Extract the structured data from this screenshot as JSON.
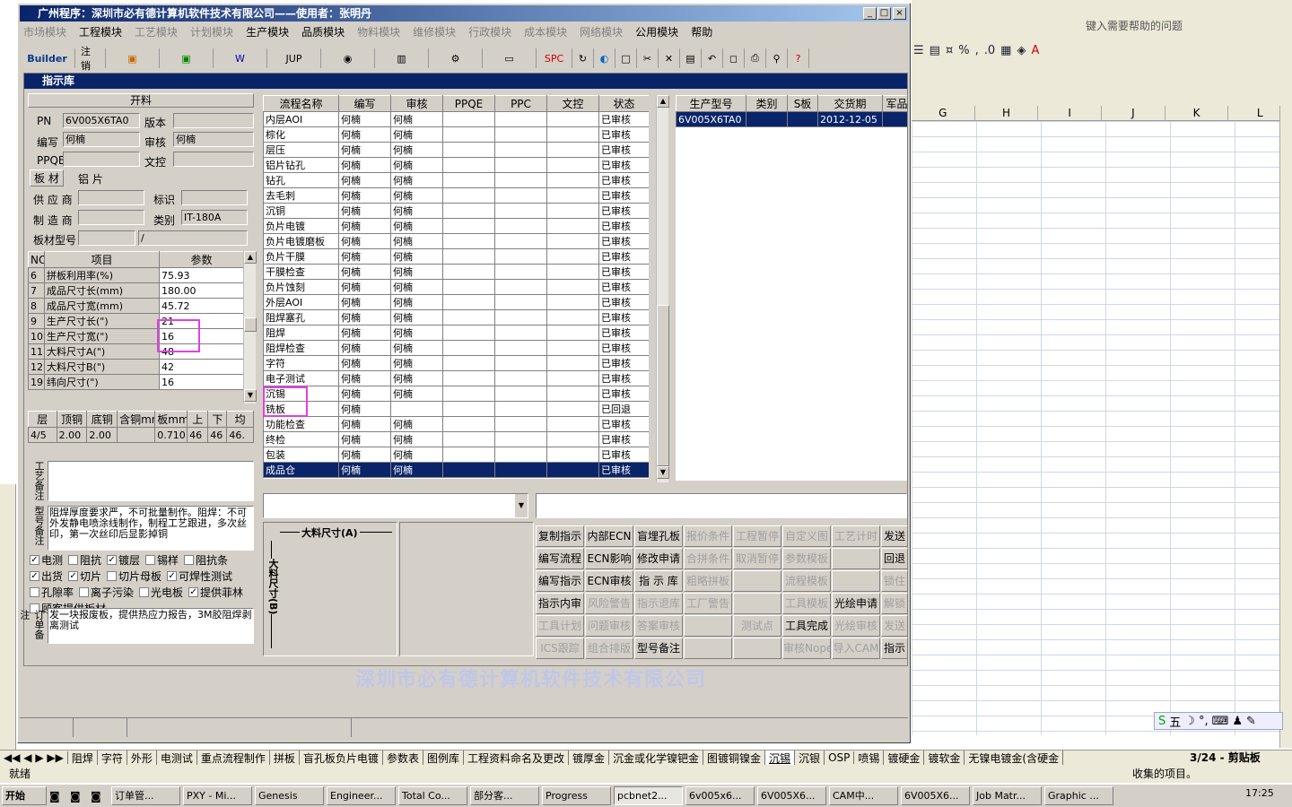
{
  "window": {
    "title": "广州程序：深圳市必有德计算机软件技术有限公司——使用者：张明丹"
  },
  "menu": [
    {
      "label": "市场模块",
      "enabled": false
    },
    {
      "label": "工程模块",
      "enabled": true
    },
    {
      "label": "工艺模块",
      "enabled": false
    },
    {
      "label": "计划模块",
      "enabled": false
    },
    {
      "label": "生产模块",
      "enabled": true
    },
    {
      "label": "品质模块",
      "enabled": true
    },
    {
      "label": "物料模块",
      "enabled": false
    },
    {
      "label": "维修模块",
      "enabled": false
    },
    {
      "label": "行政模块",
      "enabled": false
    },
    {
      "label": "成本模块",
      "enabled": false
    },
    {
      "label": "网络模块",
      "enabled": false
    },
    {
      "label": "公用模块",
      "enabled": true
    },
    {
      "label": "帮助",
      "enabled": true
    }
  ],
  "toolbar": {
    "builder": "Builder",
    "cancel": "注销",
    "jup": "JUP",
    "spc": "SPC"
  },
  "subwindow": {
    "title": "指示库"
  },
  "left": {
    "header": "开料",
    "pn_label": "PN",
    "pn": "6V005X6TA0",
    "version_label": "版本",
    "version": "",
    "editor_label": "编写",
    "editor": "何楠",
    "reviewer_label": "审核",
    "reviewer": "何楠",
    "ppqe_label": "PPQE",
    "ppqe": "",
    "wenkong_label": "文控",
    "wenkong": "",
    "tab_board": "板 材",
    "tab_al": "铝 片",
    "supplier_label": "供 应 商",
    "supplier": "",
    "mark_label": "标识",
    "mark": "",
    "maker_label": "制 造 商",
    "maker": "",
    "category_label": "类别",
    "category": "IT-180A",
    "model_label": "板材型号",
    "model": "",
    "model2": "/"
  },
  "params": {
    "headers": [
      "NO",
      "项目",
      "参数"
    ],
    "rows": [
      [
        "6",
        "拼板利用率(%)",
        "75.93"
      ],
      [
        "7",
        "成品尺寸长(mm)",
        "180.00"
      ],
      [
        "8",
        "成品尺寸宽(mm)",
        "45.72"
      ],
      [
        "9",
        "生产尺寸长(\")",
        "21"
      ],
      [
        "10",
        "生产尺寸宽(\")",
        "16"
      ],
      [
        "11",
        "大料尺寸A(\")",
        "48"
      ],
      [
        "12",
        "大料尺寸B(\")",
        "42"
      ],
      [
        "19",
        "纬向尺寸(\")",
        "16"
      ]
    ]
  },
  "layers": {
    "headers": [
      "层",
      "顶铜",
      "底铜",
      "含铜mm",
      "板mm",
      "上",
      "下",
      "均"
    ],
    "row": [
      "4/5",
      "2.00",
      "2.00",
      "",
      "0.710",
      "46",
      "46",
      "46."
    ]
  },
  "notes": {
    "craft_label": "工艺备注",
    "craft": "",
    "model_label": "型号备注",
    "model": "阻焊厚度要求严，不可批量制作。阻焊：不可外发静电喷涂线制作，制程工艺跟进，多次丝印，第一次丝印后显影掉铜",
    "order_label": "订单备注",
    "order": "发一块报废板，提供热应力报告，3M胶阻焊剥离测试"
  },
  "checks": [
    {
      "label": "电测",
      "checked": true
    },
    {
      "label": "阻抗",
      "checked": false
    },
    {
      "label": "镀层",
      "checked": true
    },
    {
      "label": "锡样",
      "checked": false
    },
    {
      "label": "阻抗条",
      "checked": false
    },
    {
      "label": "出货",
      "checked": true
    },
    {
      "label": "切片",
      "checked": true
    },
    {
      "label": "切片母板",
      "checked": false
    },
    {
      "label": "可焊性测试",
      "checked": true
    },
    {
      "label": "孔隙率",
      "checked": false
    },
    {
      "label": "离子污染",
      "checked": false
    },
    {
      "label": "光电板",
      "checked": false
    },
    {
      "label": "提供菲林",
      "checked": true
    },
    {
      "label": "顾客提供板材",
      "checked": false
    }
  ],
  "flow": {
    "headers": [
      "流程名称",
      "编写",
      "审核",
      "PPQE",
      "PPC",
      "文控",
      "状态"
    ],
    "rows": [
      [
        "内层AOI",
        "何楠",
        "何楠",
        "",
        "",
        "",
        "已审核"
      ],
      [
        "棕化",
        "何楠",
        "何楠",
        "",
        "",
        "",
        "已审核"
      ],
      [
        "层压",
        "何楠",
        "何楠",
        "",
        "",
        "",
        "已审核"
      ],
      [
        "铝片钻孔",
        "何楠",
        "何楠",
        "",
        "",
        "",
        "已审核"
      ],
      [
        "钻孔",
        "何楠",
        "何楠",
        "",
        "",
        "",
        "已审核"
      ],
      [
        "去毛刺",
        "何楠",
        "何楠",
        "",
        "",
        "",
        "已审核"
      ],
      [
        "沉铜",
        "何楠",
        "何楠",
        "",
        "",
        "",
        "已审核"
      ],
      [
        "负片电镀",
        "何楠",
        "何楠",
        "",
        "",
        "",
        "已审核"
      ],
      [
        "负片电镀磨板",
        "何楠",
        "何楠",
        "",
        "",
        "",
        "已审核"
      ],
      [
        "负片干膜",
        "何楠",
        "何楠",
        "",
        "",
        "",
        "已审核"
      ],
      [
        "干膜检查",
        "何楠",
        "何楠",
        "",
        "",
        "",
        "已审核"
      ],
      [
        "负片蚀刻",
        "何楠",
        "何楠",
        "",
        "",
        "",
        "已审核"
      ],
      [
        "外层AOI",
        "何楠",
        "何楠",
        "",
        "",
        "",
        "已审核"
      ],
      [
        "阻焊塞孔",
        "何楠",
        "何楠",
        "",
        "",
        "",
        "已审核"
      ],
      [
        "阻焊",
        "何楠",
        "何楠",
        "",
        "",
        "",
        "已审核"
      ],
      [
        "阻焊检查",
        "何楠",
        "何楠",
        "",
        "",
        "",
        "已审核"
      ],
      [
        "字符",
        "何楠",
        "何楠",
        "",
        "",
        "",
        "已审核"
      ],
      [
        "电子测试",
        "何楠",
        "何楠",
        "",
        "",
        "",
        "已审核"
      ],
      [
        "沉锡",
        "何楠",
        "何楠",
        "",
        "",
        "",
        "已审核"
      ],
      [
        "铣板",
        "何楠",
        "",
        "",
        "",
        "",
        "已回退"
      ],
      [
        "功能检查",
        "何楠",
        "何楠",
        "",
        "",
        "",
        "已审核"
      ],
      [
        "终检",
        "何楠",
        "何楠",
        "",
        "",
        "",
        "已审核"
      ],
      [
        "包装",
        "何楠",
        "何楠",
        "",
        "",
        "",
        "已审核"
      ],
      [
        "成品仓",
        "何楠",
        "何楠",
        "",
        "",
        "",
        "已审核"
      ]
    ],
    "selected": 23
  },
  "product": {
    "headers": [
      "生产型号",
      "类别",
      "S板",
      "交货期",
      "军品"
    ],
    "rows": [
      [
        "6V005X6TA0",
        "",
        "",
        "2012-12-05",
        ""
      ]
    ]
  },
  "diagram": {
    "dim_a": "大料尺寸(A)",
    "dim_b": "大料尺寸(B)"
  },
  "buttons": [
    [
      {
        "l": "复制指示",
        "e": true
      },
      {
        "l": "内部ECN",
        "e": true
      },
      {
        "l": "盲埋孔板",
        "e": true
      },
      {
        "l": "报价条件",
        "e": false
      },
      {
        "l": "工程暂停",
        "e": false
      },
      {
        "l": "自定义图",
        "e": false
      },
      {
        "l": "工艺计时",
        "e": false
      },
      {
        "l": "发送",
        "e": true
      }
    ],
    [
      {
        "l": "编写流程",
        "e": true
      },
      {
        "l": "ECN影响",
        "e": true
      },
      {
        "l": "修改申请",
        "e": true
      },
      {
        "l": "合拼条件",
        "e": false
      },
      {
        "l": "取消暂停",
        "e": false
      },
      {
        "l": "参数模板",
        "e": false
      },
      {
        "l": "",
        "e": false
      },
      {
        "l": "回退",
        "e": true
      }
    ],
    [
      {
        "l": "编写指示",
        "e": true
      },
      {
        "l": "ECN审核",
        "e": true
      },
      {
        "l": "指 示 库",
        "e": true
      },
      {
        "l": "粗略拼板",
        "e": false
      },
      {
        "l": "",
        "e": false
      },
      {
        "l": "流程模板",
        "e": false
      },
      {
        "l": "",
        "e": false
      },
      {
        "l": "锁住",
        "e": false
      }
    ],
    [
      {
        "l": "指示内审",
        "e": true
      },
      {
        "l": "风险警告",
        "e": false
      },
      {
        "l": "指示退库",
        "e": false
      },
      {
        "l": "工厂警告",
        "e": false
      },
      {
        "l": "",
        "e": false
      },
      {
        "l": "工具模板",
        "e": false
      },
      {
        "l": "光绘申请",
        "e": true
      },
      {
        "l": "解锁",
        "e": false
      }
    ],
    [
      {
        "l": "工具计划",
        "e": false
      },
      {
        "l": "问题审核",
        "e": false
      },
      {
        "l": "答案审核",
        "e": false
      },
      {
        "l": "",
        "e": false
      },
      {
        "l": "测试点",
        "e": false
      },
      {
        "l": "工具完成",
        "e": true
      },
      {
        "l": "光绘审核",
        "e": false
      },
      {
        "l": "发送",
        "e": false
      }
    ],
    [
      {
        "l": "ICS跟踪",
        "e": false
      },
      {
        "l": "组合排版",
        "e": false
      },
      {
        "l": "型号备注",
        "e": true
      },
      {
        "l": "",
        "e": false
      },
      {
        "l": "",
        "e": false
      },
      {
        "l": "审核Nope",
        "e": false
      },
      {
        "l": "导入CAM",
        "e": false
      },
      {
        "l": "指示",
        "e": true
      }
    ]
  ],
  "watermark": "深圳市必有德计算机软件技术有限公司",
  "excel": {
    "help": "键入需要帮助的问题",
    "cols": [
      "G",
      "H",
      "I",
      "J",
      "K",
      "L"
    ],
    "status": "就绪",
    "clip": "3/24 - 剪贴板",
    "status_right": "收集的项目。"
  },
  "sheets": [
    "阻焊",
    "字符",
    "外形",
    "电测试",
    "重点流程制作",
    "拼板",
    "盲孔板负片电镀",
    "参数表",
    "图例库",
    "工程资料命名及更改",
    "镀厚金",
    "沉金或化学镍钯金",
    "图镀铜镍金",
    "沉锡",
    "沉银",
    "OSP",
    "喷锡",
    "镀硬金",
    "镀软金",
    "无镍电镀金(含硬金"
  ],
  "active_sheet": "沉锡",
  "taskbar": {
    "start": "开始",
    "items": [
      "订单管...",
      "PXY - Mi...",
      "Genesis",
      "Engineer...",
      "Total Co...",
      "部分客...",
      "Progress",
      "pcbnet2...",
      "6v005x6...",
      "6V005X6...",
      "CAM中...",
      "6V005X6...",
      "Job Matr...",
      "Graphic ..."
    ],
    "active": "pcbnet2...",
    "clock": "17:25"
  }
}
